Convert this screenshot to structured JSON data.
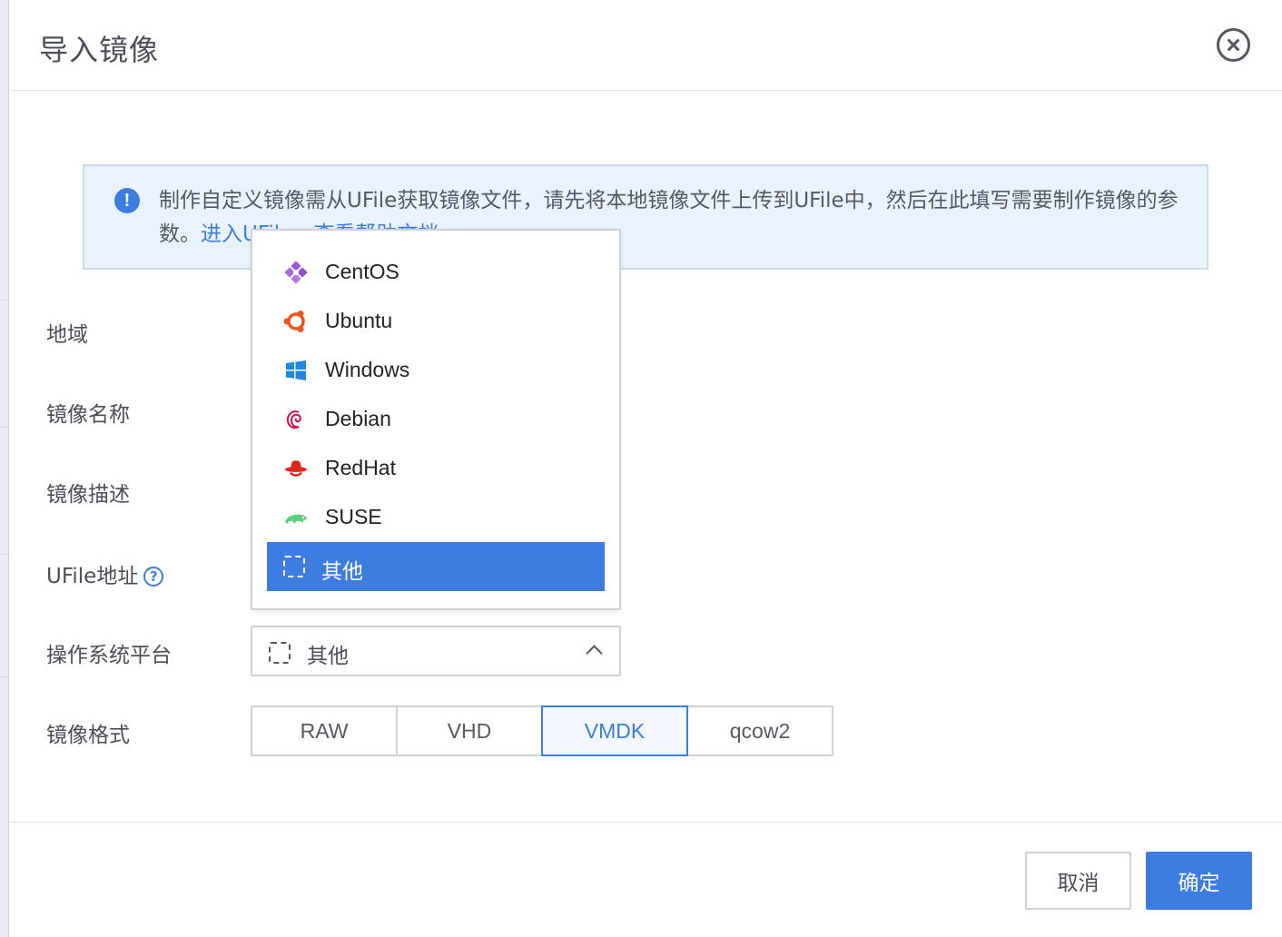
{
  "modal": {
    "title": "导入镜像",
    "close_label": "close"
  },
  "info": {
    "text_prefix": "制作自定义镜像需从UFile获取镜像文件，请先将本地镜像文件上传到UFile中，然后在此填写需要制作镜像的参数。",
    "link_ufile": "进入UFile",
    "link_help": "查看帮助文档"
  },
  "form": {
    "region_label": "地域",
    "image_name_label": "镜像名称",
    "image_desc_label": "镜像描述",
    "ufile_label": "UFile地址",
    "help_glyph": "?",
    "os_label": "操作系统平台",
    "format_label": "镜像格式",
    "os_selected": "其他",
    "formats": [
      "RAW",
      "VHD",
      "VMDK",
      "qcow2"
    ],
    "format_active": "VMDK"
  },
  "os_options": [
    {
      "label": "CentOS",
      "icon": "centos-icon"
    },
    {
      "label": "Ubuntu",
      "icon": "ubuntu-icon"
    },
    {
      "label": "Windows",
      "icon": "windows-icon"
    },
    {
      "label": "Debian",
      "icon": "debian-icon"
    },
    {
      "label": "RedHat",
      "icon": "redhat-icon"
    },
    {
      "label": "SUSE",
      "icon": "suse-icon"
    },
    {
      "label": "其他",
      "icon": "other-icon",
      "selected": true
    }
  ],
  "footer": {
    "cancel_label": "取消",
    "ok_label": "确定"
  },
  "colors": {
    "accent": "#3d7ce0",
    "info_bg": "#eaf3fd"
  }
}
